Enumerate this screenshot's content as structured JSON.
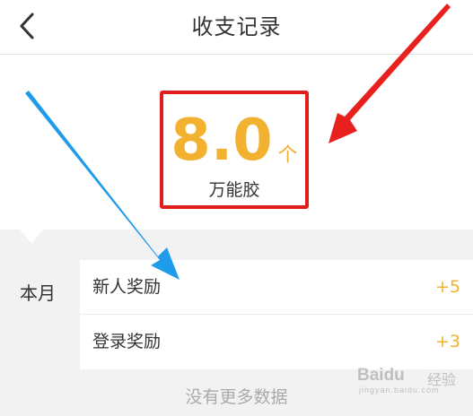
{
  "header": {
    "back_icon": "chevron-left-icon",
    "title": "收支记录"
  },
  "balance": {
    "amount": "8.0",
    "unit": "个",
    "currency_name": "万能胶",
    "highlight_color": "#e11d1d",
    "amount_color": "#f2b230"
  },
  "records": {
    "period_label": "本月",
    "items": [
      {
        "name": "新人奖励",
        "value": "+5"
      },
      {
        "name": "登录奖励",
        "value": "+3"
      }
    ],
    "empty_message": "没有更多数据"
  },
  "annotations": {
    "red_arrow_color": "#e8201e",
    "blue_arrow_color": "#1e9bea"
  },
  "watermark": {
    "brand": "Baidu",
    "sub": "经验",
    "url": "jingyan.baidu.com"
  }
}
